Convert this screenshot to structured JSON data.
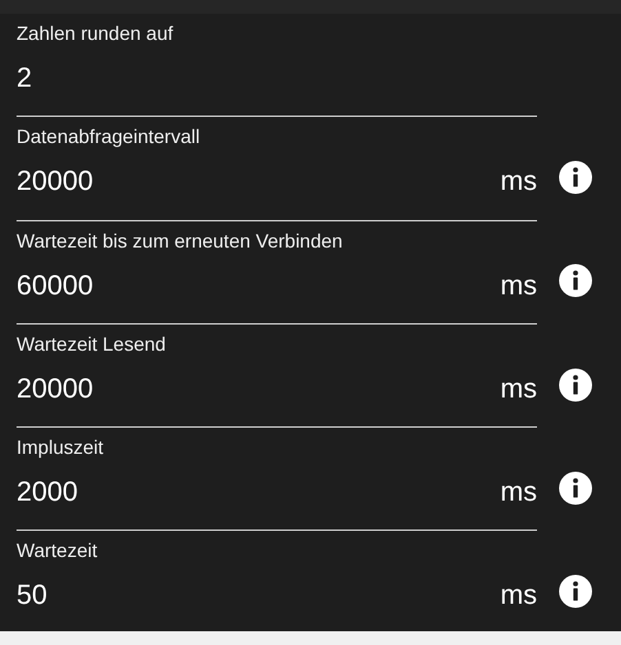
{
  "fields": [
    {
      "label": "Zahlen runden auf",
      "value": "2",
      "info": false
    },
    {
      "label": "Datenabfrageintervall",
      "value": "20000",
      "unit": "ms",
      "info": true
    },
    {
      "label": "Wartezeit bis zum erneuten Verbinden",
      "value": "60000",
      "unit": "ms",
      "info": true
    },
    {
      "label": "Wartezeit Lesend",
      "value": "20000",
      "unit": "ms",
      "info": true
    },
    {
      "label": "Impluszeit",
      "value": "2000",
      "unit": "ms",
      "info": true
    },
    {
      "label": "Wartezeit",
      "value": "50",
      "unit": "ms",
      "info": true
    }
  ]
}
